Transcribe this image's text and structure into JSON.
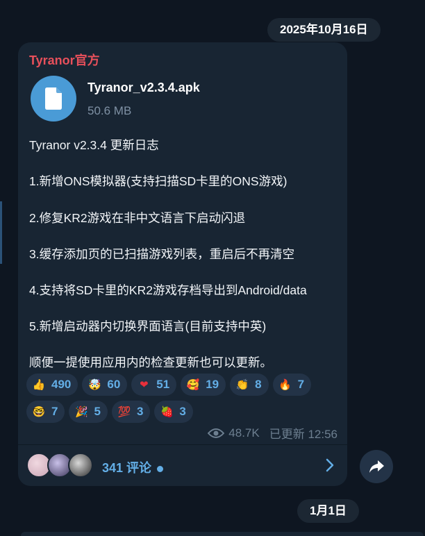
{
  "dates": {
    "top": "2025年10月16日",
    "bottom": "1月1日"
  },
  "post": {
    "channel_name": "Tyranor官方",
    "file": {
      "name": "Tyranor_v2.3.4.apk",
      "size": "50.6 MB",
      "icon": "file-icon"
    },
    "lines": [
      "Tyranor v2.3.4 更新日志",
      "1.新增ONS模拟器(支持扫描SD卡里的ONS游戏)",
      "2.修复KR2游戏在非中文语言下启动闪退",
      "3.缓存添加页的已扫描游戏列表，重启后不再清空",
      "4.支持将SD卡里的KR2游戏存档导出到Android/data",
      "5.新增启动器内切换界面语言(目前支持中英)",
      "顺便一提使用应用内的检查更新也可以更新。"
    ],
    "reactions": [
      {
        "emoji": "👍",
        "name": "thumbs-up",
        "count": "490"
      },
      {
        "emoji": "🤯",
        "name": "exploding-head",
        "count": "60"
      },
      {
        "emoji": "❤",
        "name": "heart",
        "count": "51"
      },
      {
        "emoji": "🥰",
        "name": "smiling-hearts",
        "count": "19"
      },
      {
        "emoji": "👏",
        "name": "clapping",
        "count": "8"
      },
      {
        "emoji": "🔥",
        "name": "fire",
        "count": "7"
      },
      {
        "emoji": "🤓",
        "name": "nerd-face",
        "count": "7"
      },
      {
        "emoji": "🎉",
        "name": "party-popper",
        "count": "5"
      },
      {
        "emoji": "💯",
        "name": "hundred",
        "count": "3"
      },
      {
        "emoji": "🍓",
        "name": "strawberry",
        "count": "3"
      }
    ],
    "views": "48.7K",
    "edited_time": "已更新 12:56",
    "comments_label": "341 评论"
  },
  "colors": {
    "background": "#0e1621",
    "bubble": "#182533",
    "accent": "#63aee6",
    "channel_name": "#e8505b"
  }
}
